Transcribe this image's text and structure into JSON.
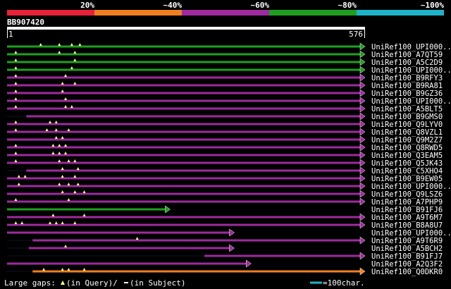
{
  "query_id": "BB907420",
  "ruler": {
    "start": "1",
    "end": "576"
  },
  "colorbar": [
    {
      "label": "20%",
      "color": "#e8213a"
    },
    {
      "label": "~40%",
      "color": "#f07f21"
    },
    {
      "label": "~60%",
      "color": "#9e2a9e"
    },
    {
      "label": "~80%",
      "color": "#1f9f1f"
    },
    {
      "label": "~100%",
      "color": "#1fb3c7"
    }
  ],
  "chart_data": {
    "type": "alignment-overview",
    "query_length": 576,
    "hits": [
      {
        "name": "UniRef100_UPI000..",
        "color": "green",
        "start": 1,
        "end": 576,
        "gaps": [
          55,
          85,
          105,
          118
        ]
      },
      {
        "name": "UniRef100_A7QT59",
        "color": "green",
        "start": 1,
        "end": 576,
        "gaps": [
          15,
          85,
          110
        ]
      },
      {
        "name": "UniRef100_A5C2D9",
        "color": "green",
        "start": 1,
        "end": 576,
        "gaps": [
          15,
          110
        ]
      },
      {
        "name": "UniRef100_UPI000..",
        "color": "green",
        "start": 1,
        "end": 576,
        "gaps": [
          15,
          105
        ]
      },
      {
        "name": "UniRef100_B9RFY3",
        "color": "purple",
        "start": 1,
        "end": 576,
        "gaps": [
          15,
          95
        ]
      },
      {
        "name": "UniRef100_B9RA81",
        "color": "purple",
        "start": 1,
        "end": 576,
        "gaps": [
          15,
          90,
          110
        ]
      },
      {
        "name": "UniRef100_B9GZ36",
        "color": "purple",
        "start": 1,
        "end": 576,
        "gaps": [
          15,
          90
        ]
      },
      {
        "name": "UniRef100_UPI000..",
        "color": "purple",
        "start": 1,
        "end": 576,
        "gaps": [
          15,
          95
        ]
      },
      {
        "name": "UniRef100_A5BLT5",
        "color": "purple",
        "start": 1,
        "end": 576,
        "gaps": [
          15,
          95,
          105
        ]
      },
      {
        "name": "UniRef100_B9GMS0",
        "color": "purple",
        "start": 32,
        "end": 576,
        "gaps": []
      },
      {
        "name": "UniRef100_Q9LYV0",
        "color": "purple",
        "start": 1,
        "end": 576,
        "gaps": [
          15,
          70,
          80
        ]
      },
      {
        "name": "UniRef100_Q8VZL1",
        "color": "purple",
        "start": 1,
        "end": 576,
        "gaps": [
          15,
          65,
          80,
          100
        ]
      },
      {
        "name": "UniRef100_Q9M2Z7",
        "color": "purple",
        "start": 1,
        "end": 576,
        "gaps": [
          80,
          90
        ]
      },
      {
        "name": "UniRef100_Q8RWD5",
        "color": "purple",
        "start": 1,
        "end": 576,
        "gaps": [
          15,
          75,
          85,
          95
        ]
      },
      {
        "name": "UniRef100_Q3EAM5",
        "color": "purple",
        "start": 1,
        "end": 576,
        "gaps": [
          15,
          75,
          85,
          95
        ]
      },
      {
        "name": "UniRef100_Q5JK43",
        "color": "purple",
        "start": 1,
        "end": 576,
        "gaps": [
          15,
          85,
          100,
          110
        ]
      },
      {
        "name": "UniRef100_C5XHO4",
        "color": "purple",
        "start": 32,
        "end": 576,
        "gaps": [
          90,
          115
        ]
      },
      {
        "name": "UniRef100_B9EW05",
        "color": "purple",
        "start": 1,
        "end": 576,
        "gaps": [
          20,
          30,
          90,
          110
        ]
      },
      {
        "name": "UniRef100_UPI000..",
        "color": "purple",
        "start": 1,
        "end": 576,
        "gaps": [
          20,
          85,
          100,
          115
        ]
      },
      {
        "name": "UniRef100_Q9LSZ6",
        "color": "purple",
        "start": 1,
        "end": 576,
        "gaps": [
          90,
          110,
          125
        ]
      },
      {
        "name": "UniRef100_A7PHP9",
        "color": "purple",
        "start": 1,
        "end": 576,
        "gaps": [
          15,
          100
        ]
      },
      {
        "name": "UniRef100_B91FJ6",
        "color": "green",
        "start": 1,
        "end": 263,
        "gaps": []
      },
      {
        "name": "UniRef100_A9T6M7",
        "color": "purple",
        "start": 1,
        "end": 576,
        "gaps": [
          75,
          125
        ]
      },
      {
        "name": "UniRef100_B8A8U7",
        "color": "purple",
        "start": 1,
        "end": 576,
        "gaps": [
          15,
          25,
          70,
          80,
          90,
          110
        ]
      },
      {
        "name": "UniRef100_UPI000..",
        "color": "purple",
        "start": 1,
        "end": 366,
        "gaps": []
      },
      {
        "name": "UniRef100_A9T6R9",
        "color": "purple",
        "start": 42,
        "end": 576,
        "gaps": [
          210
        ]
      },
      {
        "name": "UniRef100_A5BCH2",
        "color": "purple",
        "start": 36,
        "end": 366,
        "gaps": [
          95
        ]
      },
      {
        "name": "UniRef100_B91FJ7",
        "color": "purple",
        "start": 318,
        "end": 576,
        "gaps": []
      },
      {
        "name": "UniRef100_A2Q3F2",
        "color": "purple",
        "start": 1,
        "end": 393,
        "gaps": []
      },
      {
        "name": "UniRef100_Q0DKR0",
        "color": "orange",
        "start": 42,
        "end": 576,
        "gaps": [
          60,
          90,
          100,
          125
        ]
      }
    ]
  },
  "footer": {
    "gaps_prefix": "Large gaps:",
    "gaps_query": "(in Query)/",
    "gaps_subject": "(in Subject)",
    "scale_text": "=100char."
  },
  "colors": {
    "green": "#1f9f1f",
    "purple": "#9e2a9e",
    "orange": "#f07f21",
    "cyan": "#1fb3c7",
    "gap_marker": "#ffff99"
  }
}
